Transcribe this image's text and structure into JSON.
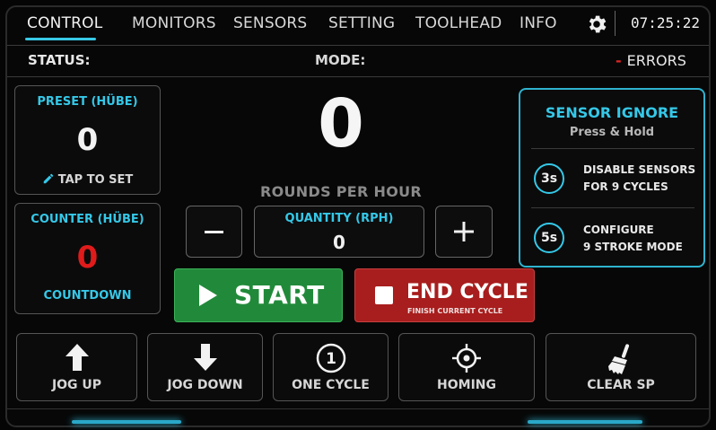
{
  "tabs": [
    {
      "label": "CONTROL",
      "active": true
    },
    {
      "label": "MONITORS",
      "active": false
    },
    {
      "label": "SENSORS",
      "active": false
    },
    {
      "label": "SETTING",
      "active": false
    },
    {
      "label": "TOOLHEAD",
      "active": false
    },
    {
      "label": "INFO",
      "active": false
    }
  ],
  "clock": "07:25:22",
  "status": {
    "label": "STATUS:",
    "mode_label": "MODE:",
    "errors_dash": "-",
    "errors_label": "ERRORS"
  },
  "preset": {
    "title": "PRESET (HÜBE)",
    "value": "0",
    "action": "TAP TO SET",
    "icon": "pencil-icon"
  },
  "counter": {
    "title": "COUNTER (HÜBE)",
    "value": "0",
    "mode": "COUNTDOWN",
    "value_color": "#e01b1b"
  },
  "rph": {
    "value": "0",
    "label": "ROUNDS PER HOUR"
  },
  "quantity": {
    "title": "QUANTITY (RPH)",
    "value": "0",
    "minus": "−",
    "plus": "+"
  },
  "start_button": {
    "label": "START"
  },
  "end_cycle_button": {
    "label": "END CYCLE",
    "sublabel": "FINISH CURRENT CYCLE"
  },
  "sensor_ignore": {
    "title": "SENSOR IGNORE",
    "subtitle": "Press & Hold",
    "rows": [
      {
        "badge": "3s",
        "line1": "DISABLE SENSORS",
        "line2": "FOR 9 CYCLES"
      },
      {
        "badge": "5s",
        "line1": "CONFIGURE",
        "line2": "9 STROKE MODE"
      }
    ]
  },
  "actions": [
    {
      "label": "JOG UP",
      "icon": "arrow-up-icon"
    },
    {
      "label": "JOG DOWN",
      "icon": "arrow-down-icon"
    },
    {
      "label": "ONE CYCLE",
      "icon": "one-circle-icon",
      "icon_text": "1"
    },
    {
      "label": "HOMING",
      "icon": "crosshair-icon"
    },
    {
      "label": "CLEAR SP",
      "icon": "broom-icon"
    }
  ],
  "colors": {
    "accent": "#35c8e8",
    "start": "#218a3a",
    "end": "#a81d1d",
    "error": "#e01b1b"
  }
}
